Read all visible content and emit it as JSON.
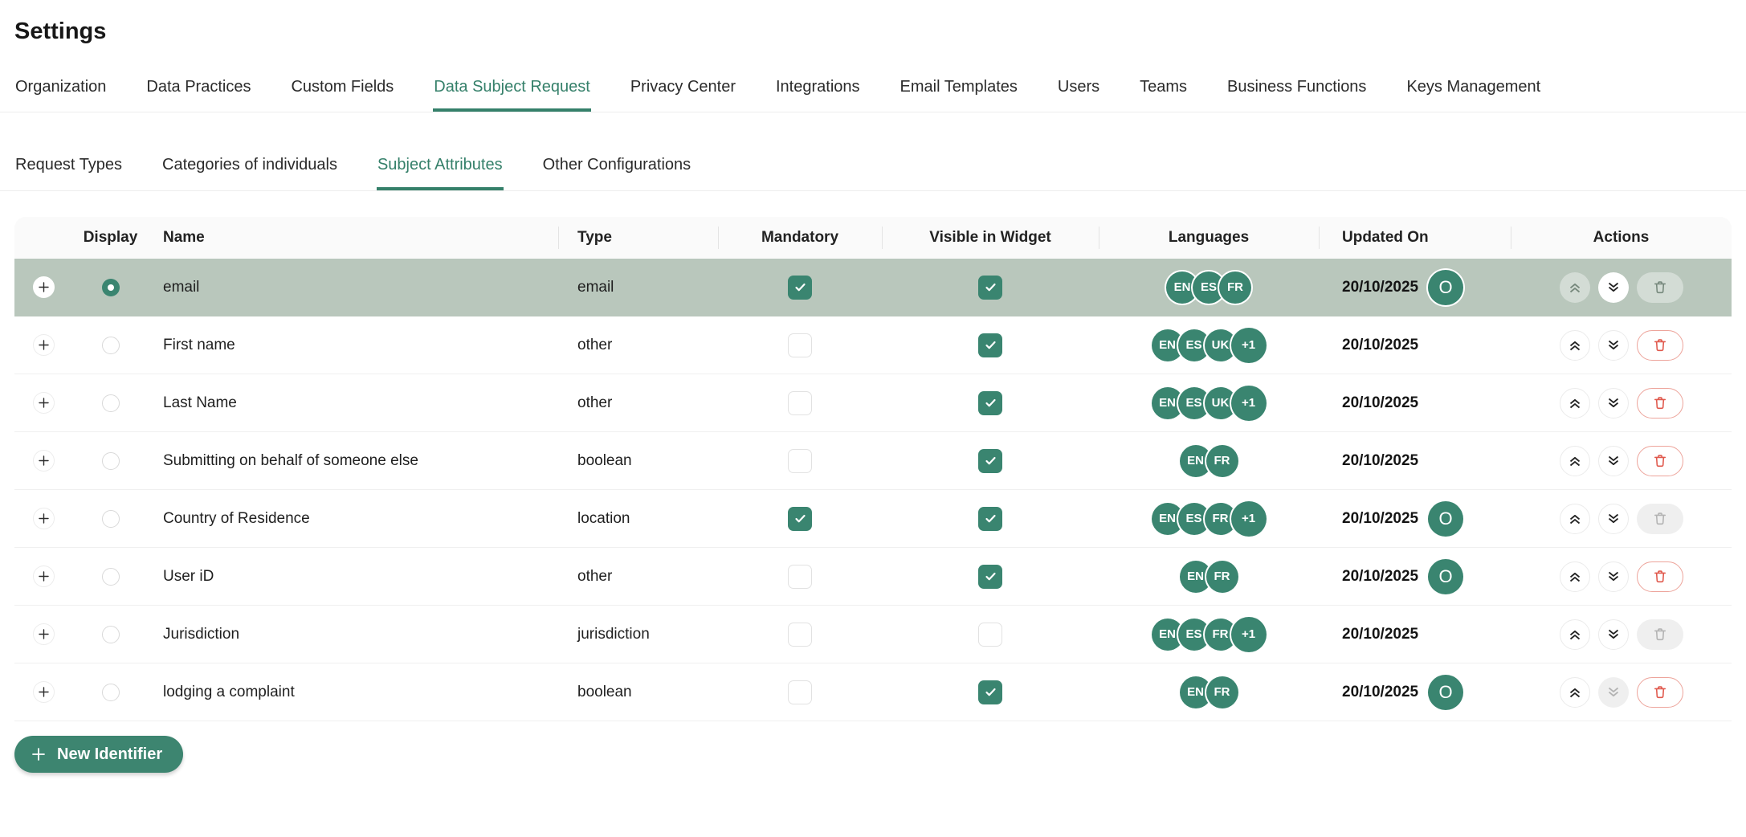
{
  "page": {
    "title": "Settings"
  },
  "tabs": [
    {
      "label": "Organization",
      "active": false
    },
    {
      "label": "Data Practices",
      "active": false
    },
    {
      "label": "Custom Fields",
      "active": false
    },
    {
      "label": "Data Subject Request",
      "active": true
    },
    {
      "label": "Privacy Center",
      "active": false
    },
    {
      "label": "Integrations",
      "active": false
    },
    {
      "label": "Email Templates",
      "active": false
    },
    {
      "label": "Users",
      "active": false
    },
    {
      "label": "Teams",
      "active": false
    },
    {
      "label": "Business Functions",
      "active": false
    },
    {
      "label": "Keys Management",
      "active": false
    }
  ],
  "subtabs": [
    {
      "label": "Request Types",
      "active": false
    },
    {
      "label": "Categories of individuals",
      "active": false
    },
    {
      "label": "Subject Attributes",
      "active": true
    },
    {
      "label": "Other Configurations",
      "active": false
    }
  ],
  "table": {
    "columns": [
      "Display",
      "Name",
      "Type",
      "Mandatory",
      "Visible in Widget",
      "Languages",
      "Updated On",
      "Actions"
    ],
    "rows": [
      {
        "name": "email",
        "type": "email",
        "selected": true,
        "display_on": true,
        "mandatory": true,
        "visible": true,
        "languages": [
          "EN",
          "ES",
          "FR"
        ],
        "extra": null,
        "updated": "20/10/2025",
        "avatar": "O",
        "up_disabled": true,
        "down_disabled": false,
        "delete_disabled": true
      },
      {
        "name": "First name",
        "type": "other",
        "selected": false,
        "display_on": false,
        "mandatory": false,
        "visible": true,
        "languages": [
          "EN",
          "ES",
          "UK"
        ],
        "extra": "+1",
        "updated": "20/10/2025",
        "avatar": null,
        "up_disabled": false,
        "down_disabled": false,
        "delete_disabled": false
      },
      {
        "name": "Last Name",
        "type": "other",
        "selected": false,
        "display_on": false,
        "mandatory": false,
        "visible": true,
        "languages": [
          "EN",
          "ES",
          "UK"
        ],
        "extra": "+1",
        "updated": "20/10/2025",
        "avatar": null,
        "up_disabled": false,
        "down_disabled": false,
        "delete_disabled": false
      },
      {
        "name": "Submitting on behalf of someone else",
        "type": "boolean",
        "selected": false,
        "display_on": false,
        "mandatory": false,
        "visible": true,
        "languages": [
          "EN",
          "FR"
        ],
        "extra": null,
        "updated": "20/10/2025",
        "avatar": null,
        "up_disabled": false,
        "down_disabled": false,
        "delete_disabled": false
      },
      {
        "name": "Country of Residence",
        "type": "location",
        "selected": false,
        "display_on": false,
        "mandatory": true,
        "visible": true,
        "languages": [
          "EN",
          "ES",
          "FR"
        ],
        "extra": "+1",
        "updated": "20/10/2025",
        "avatar": "O",
        "up_disabled": false,
        "down_disabled": false,
        "delete_disabled": true
      },
      {
        "name": "User iD",
        "type": "other",
        "selected": false,
        "display_on": false,
        "mandatory": false,
        "visible": true,
        "languages": [
          "EN",
          "FR"
        ],
        "extra": null,
        "updated": "20/10/2025",
        "avatar": "O",
        "up_disabled": false,
        "down_disabled": false,
        "delete_disabled": false
      },
      {
        "name": "Jurisdiction",
        "type": "jurisdiction",
        "selected": false,
        "display_on": false,
        "mandatory": false,
        "visible": false,
        "languages": [
          "EN",
          "ES",
          "FR"
        ],
        "extra": "+1",
        "updated": "20/10/2025",
        "avatar": null,
        "up_disabled": false,
        "down_disabled": false,
        "delete_disabled": true
      },
      {
        "name": "lodging a complaint",
        "type": "boolean",
        "selected": false,
        "display_on": false,
        "mandatory": false,
        "visible": true,
        "languages": [
          "EN",
          "FR"
        ],
        "extra": null,
        "updated": "20/10/2025",
        "avatar": "O",
        "up_disabled": false,
        "down_disabled": true,
        "delete_disabled": false
      }
    ]
  },
  "new_identifier": {
    "label": "New Identifier"
  },
  "colors": {
    "primary_green": "#35806a",
    "badge_green": "#3a8570",
    "selected_row": "#b9c7bc",
    "delete_red": "#e0584c"
  }
}
